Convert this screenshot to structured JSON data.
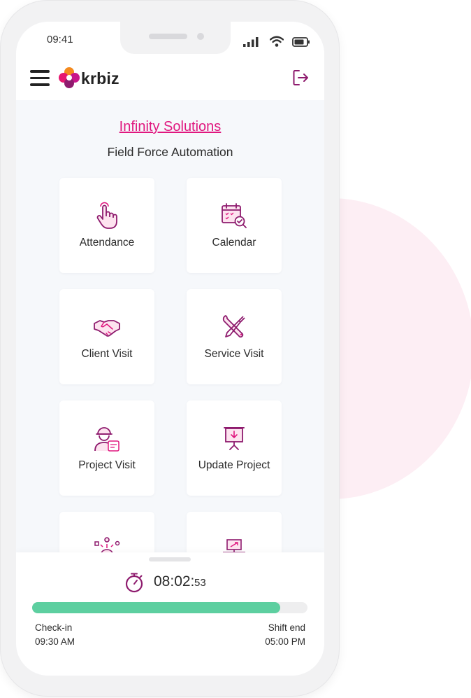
{
  "status_bar": {
    "time": "09:41"
  },
  "header": {
    "logo_text": "krbiz",
    "logout_icon": "logout-icon",
    "menu_icon": "hamburger-menu-icon"
  },
  "main": {
    "company": "Infinity Solutions",
    "subtitle": "Field Force Automation",
    "tiles": [
      {
        "label": "Attendance",
        "icon": "touch-hand-icon"
      },
      {
        "label": "Calendar",
        "icon": "calendar-check-icon"
      },
      {
        "label": "Client Visit",
        "icon": "handshake-icon"
      },
      {
        "label": "Service Visit",
        "icon": "tools-icon"
      },
      {
        "label": "Project Visit",
        "icon": "engineer-icon"
      },
      {
        "label": "Update Project",
        "icon": "presentation-board-icon"
      },
      {
        "label": "",
        "icon": "team-network-icon"
      },
      {
        "label": "",
        "icon": "desk-computer-icon"
      }
    ]
  },
  "shift": {
    "timer_main": "08:02:",
    "timer_seconds": "53",
    "progress": 0.9,
    "checkin_label": "Check-in",
    "checkin_time": "09:30 AM",
    "shift_end_label": "Shift end",
    "shift_end_time": "05:00 PM"
  },
  "colors": {
    "accent": "#e0177f",
    "icon": "#8e1b6e",
    "progress": "#5dcfa0",
    "background_circle": "#fdeef4"
  }
}
